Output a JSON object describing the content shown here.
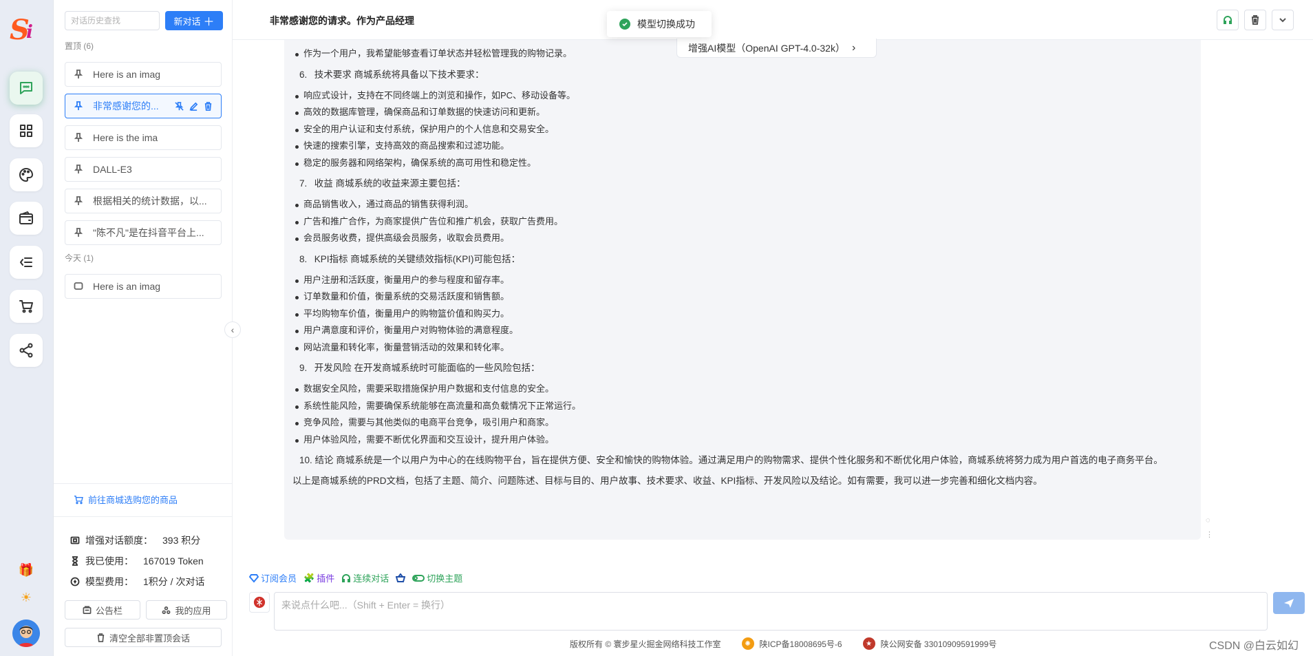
{
  "rail": {
    "items": [
      "chat-icon",
      "apps-icon",
      "palette-icon",
      "wallet-icon",
      "menu-icon",
      "cart-icon",
      "share-icon"
    ],
    "active": "chat-icon",
    "mini": [
      "gift-icon",
      "sun-icon"
    ]
  },
  "sidebar": {
    "search_placeholder": "对话历史查找",
    "new_chat": "新对话",
    "groups": {
      "pinned_label": "置顶 (6)",
      "today_label": "今天 (1)"
    },
    "pinned": [
      {
        "title": "Here is an imag"
      },
      {
        "title": "非常感谢您的..."
      },
      {
        "title": "Here is the ima"
      },
      {
        "title": "DALL-E3"
      },
      {
        "title": "根据相关的统计数据，以..."
      },
      {
        "title": "\"陈不凡\"是在抖音平台上..."
      }
    ],
    "today": [
      {
        "title": "Here is an imag"
      }
    ],
    "shop_link": "前往商城选购您的商品",
    "stats": {
      "quota_label": "增强对话额度：",
      "quota_value": "393 积分",
      "used_label": "我已使用：",
      "used_value": "167019 Token",
      "cost_label": "模型费用：",
      "cost_value": "1积分 / 次对话"
    },
    "notice_btn": "公告栏",
    "apps_btn": "我的应用",
    "clear_btn": "清空全部非置顶会话"
  },
  "header": {
    "title": "非常感谢您的请求。作为产品经理"
  },
  "toast": {
    "text": "模型切换成功"
  },
  "model": {
    "label": "增强AI模型（OpenAI GPT-4.0-32k）"
  },
  "message": {
    "top_bullet": "作为一个用户，我希望能够查看订单状态并轻松管理我的购物记录。",
    "sections": [
      {
        "num": "6.",
        "heading": "技术要求 商城系统将具备以下技术要求：",
        "bullets": [
          "响应式设计，支持在不同终端上的浏览和操作，如PC、移动设备等。",
          "高效的数据库管理，确保商品和订单数据的快速访问和更新。",
          "安全的用户认证和支付系统，保护用户的个人信息和交易安全。",
          "快速的搜索引擎，支持高效的商品搜索和过滤功能。",
          "稳定的服务器和网络架构，确保系统的高可用性和稳定性。"
        ]
      },
      {
        "num": "7.",
        "heading": "收益 商城系统的收益来源主要包括：",
        "bullets": [
          "商品销售收入，通过商品的销售获得利润。",
          "广告和推广合作，为商家提供广告位和推广机会，获取广告费用。",
          "会员服务收费，提供高级会员服务，收取会员费用。"
        ]
      },
      {
        "num": "8.",
        "heading": "KPI指标 商城系统的关键绩效指标(KPI)可能包括：",
        "bullets": [
          "用户注册和活跃度，衡量用户的参与程度和留存率。",
          "订单数量和价值，衡量系统的交易活跃度和销售额。",
          "平均购物车价值，衡量用户的购物篮价值和购买力。",
          "用户满意度和评价，衡量用户对购物体验的满意程度。",
          "网站流量和转化率，衡量营销活动的效果和转化率。"
        ]
      },
      {
        "num": "9.",
        "heading": "开发风险 在开发商城系统时可能面临的一些风险包括：",
        "bullets": [
          "数据安全风险，需要采取措施保护用户数据和支付信息的安全。",
          "系统性能风险，需要确保系统能够在高流量和高负载情况下正常运行。",
          "竞争风险，需要与其他类似的电商平台竞争，吸引用户和商家。",
          "用户体验风险，需要不断优化界面和交互设计，提升用户体验。"
        ]
      },
      {
        "num": "10.",
        "heading": "结论 商城系统是一个以用户为中心的在线购物平台，旨在提供方便、安全和愉快的购物体验。通过满足用户的购物需求、提供个性化服务和不断优化用户体验，商城系统将努力成为用户首选的电子商务平台。",
        "bullets": []
      }
    ],
    "summary": "以上是商城系统的PRD文档，包括了主题、简介、问题陈述、目标与目的、用户故事、技术要求、收益、KPI指标、开发风险以及结论。如有需要，我可以进一步完善和细化文档内容。"
  },
  "toolbar": {
    "member": "订阅会员",
    "plugin": "插件",
    "continuous": "连续对话",
    "theme": "切换主题"
  },
  "input": {
    "placeholder": "来说点什么吧...（Shift + Enter = 换行）"
  },
  "footer": {
    "copyright": "版权所有 © 寰步星火掘金网络科技工作室",
    "icp": "陕ICP备18008695号-6",
    "police": "陕公网安备 33010909591999号"
  },
  "watermark": "CSDN @白云如幻",
  "colors": {
    "accent": "#2d7ef7",
    "success": "#2ea35a",
    "rail_bg": "#e8ecf4",
    "message_bg": "#f4f5f8"
  }
}
